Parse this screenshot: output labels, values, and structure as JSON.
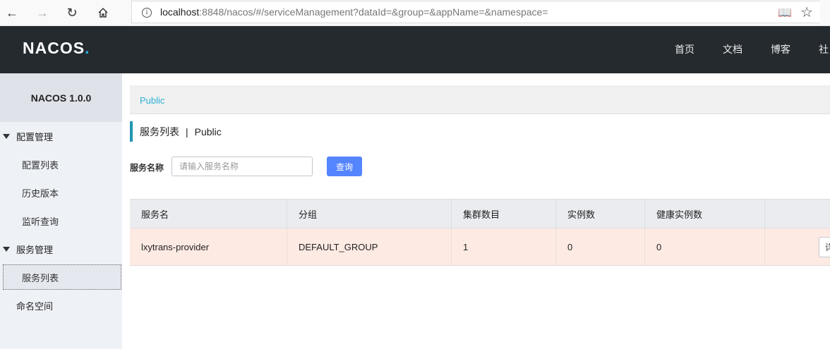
{
  "browser": {
    "url_host": "localhost",
    "url_rest": ":8848/nacos/#/serviceManagement?dataId=&group=&appName=&namespace="
  },
  "header": {
    "logo_main": "NACOS",
    "logo_dot": ".",
    "nav": [
      "首页",
      "文档",
      "博客",
      "社"
    ]
  },
  "sidebar": {
    "title": "NACOS 1.0.0",
    "config_group": "配置管理",
    "config_items": [
      "配置列表",
      "历史版本",
      "监听查询"
    ],
    "service_group": "服务管理",
    "service_items": [
      "服务列表"
    ],
    "namespace": "命名空间"
  },
  "main": {
    "namespace_link": "Public",
    "title": "服务列表",
    "title_sep": "|",
    "title_ns": "Public",
    "filter_label": "服务名称",
    "search_placeholder": "请输入服务名称",
    "query_button": "查询"
  },
  "table": {
    "columns": [
      "服务名",
      "分组",
      "集群数目",
      "实例数",
      "健康实例数"
    ],
    "rows": [
      {
        "name": "lxytrans-provider",
        "group": "DEFAULT_GROUP",
        "clusters": "1",
        "instances": "0",
        "healthy": "0",
        "action": "详"
      }
    ]
  },
  "colors": {
    "header_bg": "#252a2f",
    "accent": "#5584ff",
    "link": "#2db2d6",
    "row_highlight": "#fdeae3"
  }
}
